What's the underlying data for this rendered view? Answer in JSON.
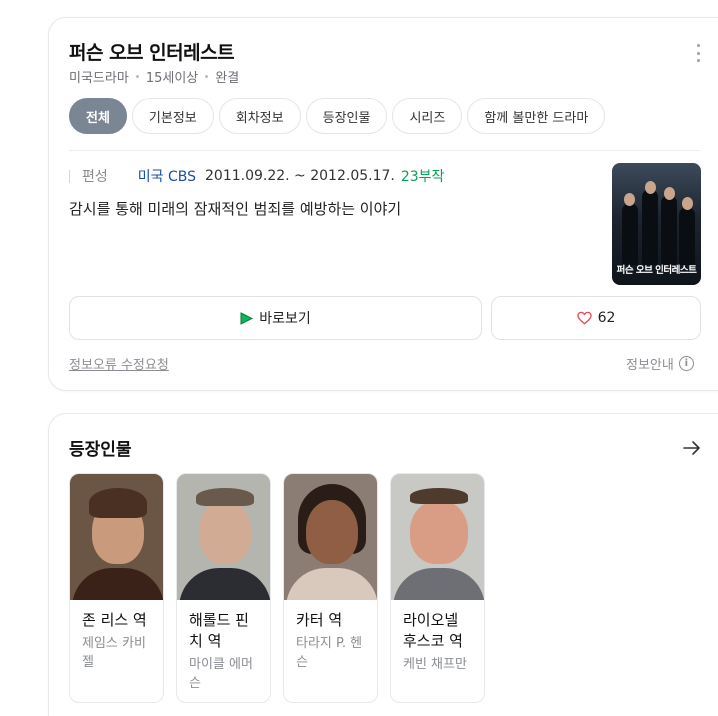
{
  "header": {
    "title": "퍼슨 오브 인터레스트",
    "meta": [
      "미국드라마",
      "15세이상",
      "완결"
    ]
  },
  "tabs": [
    {
      "label": "전체",
      "active": true
    },
    {
      "label": "기본정보",
      "active": false
    },
    {
      "label": "회차정보",
      "active": false
    },
    {
      "label": "등장인물",
      "active": false
    },
    {
      "label": "시리즈",
      "active": false
    },
    {
      "label": "함께 볼만한 드라마",
      "active": false
    }
  ],
  "detail": {
    "label": "편성",
    "network": "미국 CBS",
    "dates": "2011.09.22. ~ 2012.05.17.",
    "episodes": "23부작",
    "synopsis": "감시를 통해 미래의 잠재적인 범죄를 예방하는 이야기"
  },
  "poster": {
    "title": "퍼슨 오브 인터레스트",
    "icon": "drama-poster-image"
  },
  "actions": {
    "watch_label": "바로보기",
    "like_count": "62"
  },
  "footer_links": {
    "report": "정보오류 수정요청",
    "info": "정보안내",
    "info_glyph": "i"
  },
  "cast_section": {
    "title": "등장인물",
    "items": [
      {
        "role": "존 리스 역",
        "actor": "제임스 카비젤"
      },
      {
        "role": "해롤드 핀치 역",
        "actor": "마이클 에머슨"
      },
      {
        "role": "카터 역",
        "actor": "타라지 P. 헨슨"
      },
      {
        "role": "라이오넬 후스코 역",
        "actor": "케빈 채프만"
      }
    ]
  },
  "colors": {
    "active_tab": "#7b8694",
    "network_link": "#1a4ea3",
    "episode_count": "#0b9d58",
    "heart": "#e8484e",
    "play_icon": "#12b35a"
  }
}
